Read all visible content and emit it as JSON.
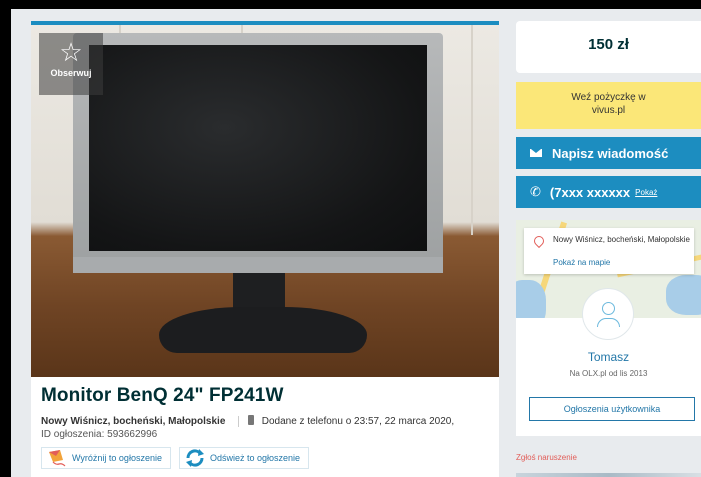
{
  "listing": {
    "watch_label": "Obserwuj",
    "title": "Monitor BenQ 24\" FP241W",
    "location": "Nowy Wiśnicz, bocheński, Małopolskie",
    "added_text": "Dodane z telefonu  o 23:57, 22 marca 2020,",
    "ad_id": "ID ogłoszenia: 593662996",
    "promote_label": "Wyróżnij to ogłoszenie",
    "refresh_label": "Odśwież to ogłoszenie"
  },
  "sidebar": {
    "price": "150 zł",
    "loan_line1": "Weź pożyczkę w",
    "loan_line2": "vivus.pl",
    "message_label": "Napisz wiadomość",
    "phone_number": "(7xxx xxxxxx",
    "phone_show": "Pokaż",
    "map_location": "Nowy Wiśnicz, bocheński, Małopolskie",
    "map_link": "Pokaż na mapie",
    "user_name": "Tomasz",
    "user_since": "Na OLX.pl od lis 2013",
    "user_ads_label": "Ogłoszenia użytkownika",
    "report_label": "Zgłoś naruszenie"
  },
  "colors": {
    "accent": "#1c8dc0",
    "loan_bg": "#fbe778",
    "title_color": "#002f34"
  }
}
